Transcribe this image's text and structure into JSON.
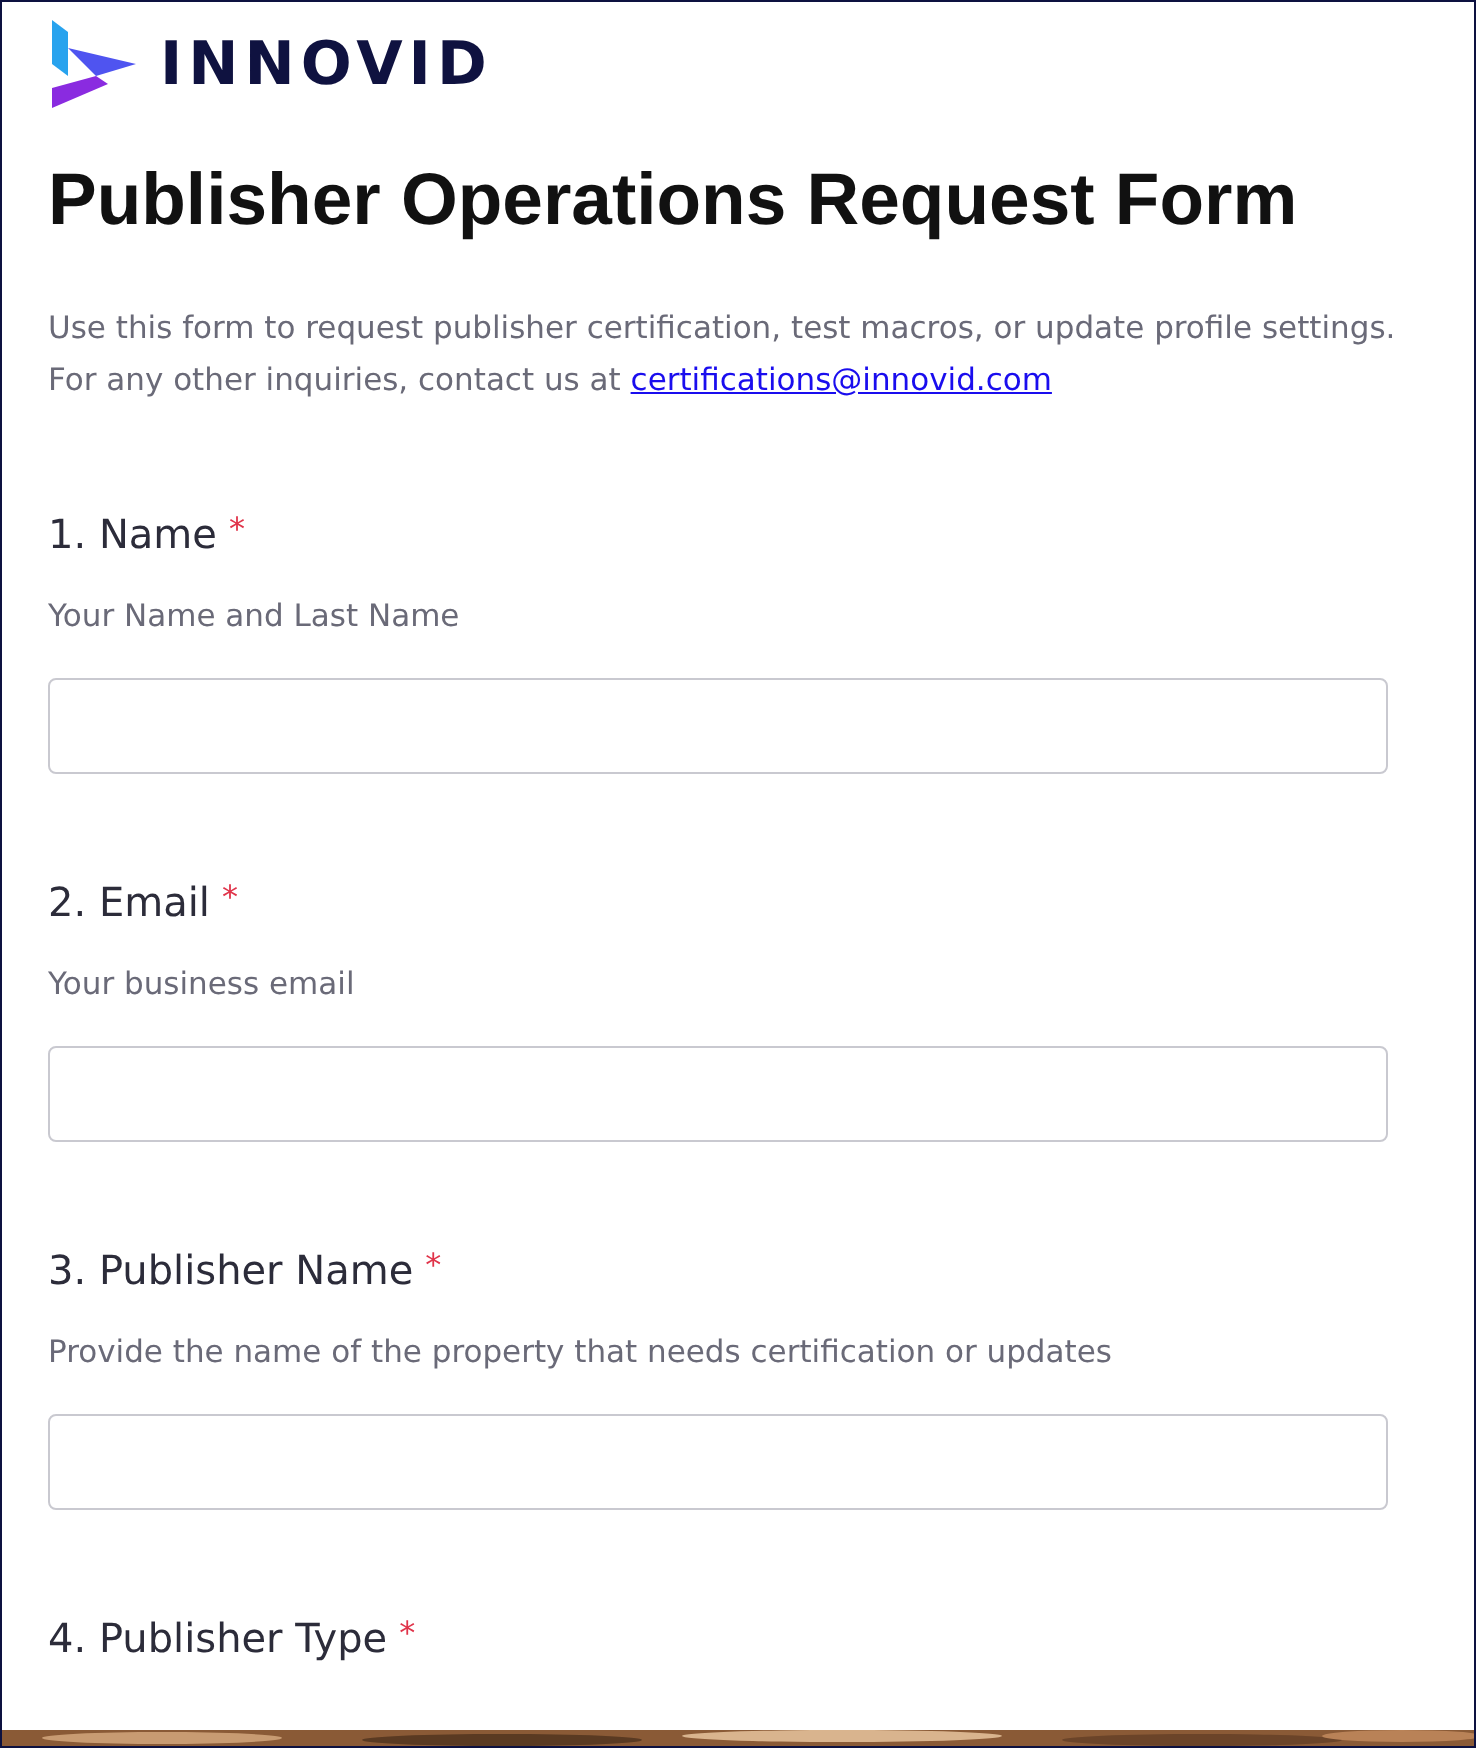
{
  "logo": {
    "wordmark": "INNOVID"
  },
  "title": "Publisher Operations Request Form",
  "description": {
    "text": "Use this form to request publisher certification, test macros, or update profile settings. For any other inquiries, contact us at ",
    "link": "certifications@innovid.com"
  },
  "questions": [
    {
      "number": "1.",
      "label": "Name",
      "required_mark": "*",
      "hint": "Your Name and Last Name",
      "kind": "text"
    },
    {
      "number": "2.",
      "label": "Email",
      "required_mark": "*",
      "hint": "Your business email",
      "kind": "text"
    },
    {
      "number": "3.",
      "label": "Publisher Name",
      "required_mark": "*",
      "hint": "Provide the name of the property that needs certification or updates",
      "kind": "text"
    },
    {
      "number": "4.",
      "label": "Publisher Type",
      "required_mark": "*",
      "kind": "heading"
    }
  ]
}
